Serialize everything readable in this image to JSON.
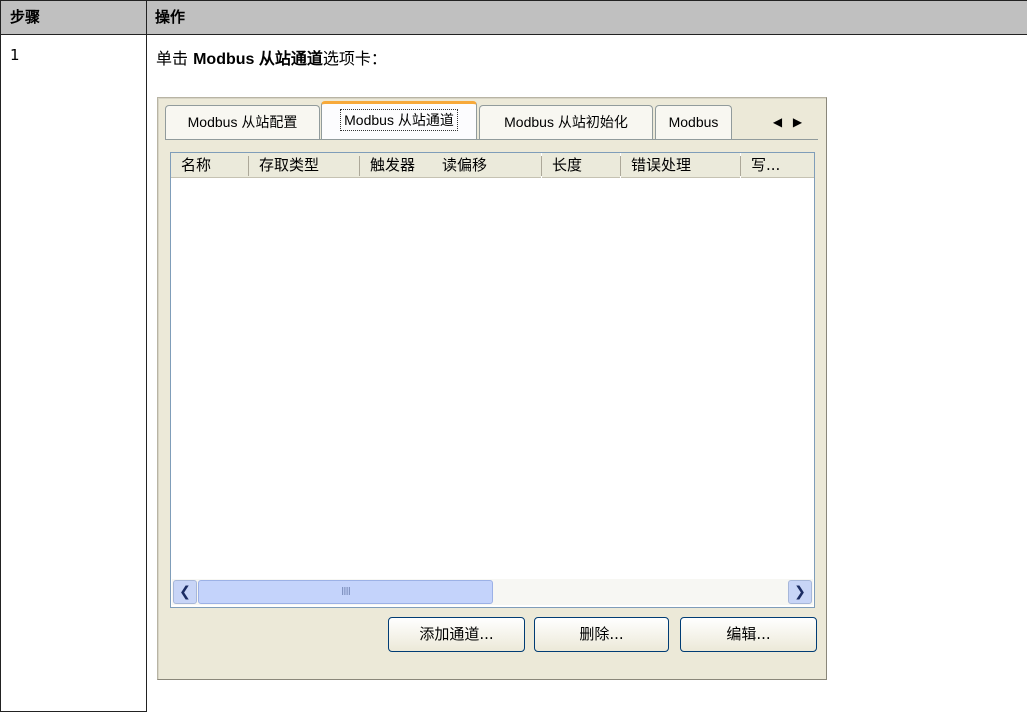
{
  "table": {
    "col_step": "步骤",
    "col_action": "操作",
    "step_number": "1",
    "instruction": {
      "prefix": "单击 ",
      "bold_latin": "Modbus ",
      "bold_cjk": "从站通道",
      "suffix": "选项卡："
    }
  },
  "dialog": {
    "tabs": [
      {
        "label": "Modbus 从站配置",
        "active": false
      },
      {
        "label": "Modbus 从站通道",
        "active": true
      },
      {
        "label": "Modbus 从站初始化",
        "active": false
      },
      {
        "label": "Modbus",
        "active": false
      }
    ],
    "nav_prev": "◀",
    "nav_next": "▶",
    "columns": [
      "名称",
      "存取类型",
      "触发器",
      "读偏移",
      "长度",
      "错误处理",
      "写..."
    ],
    "scrollbar": {
      "left_arrow": "❮",
      "right_arrow": "❯",
      "grip": "IIII"
    },
    "buttons": {
      "add": "添加通道...",
      "delete": "删除...",
      "edit": "编辑..."
    }
  }
}
